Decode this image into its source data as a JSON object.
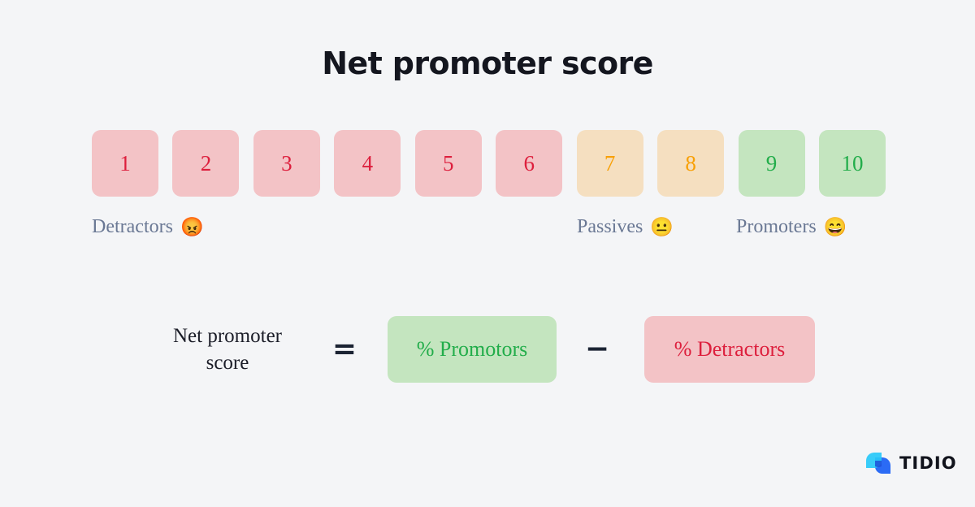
{
  "page": {
    "title": "Net promoter score",
    "background_color": "#f4f5f7"
  },
  "scale": {
    "boxes": [
      {
        "value": "1",
        "segment": "detractor",
        "bg": "#f3c3c6",
        "fg": "#dd1f3d"
      },
      {
        "value": "2",
        "segment": "detractor",
        "bg": "#f3c3c6",
        "fg": "#dd1f3d"
      },
      {
        "value": "3",
        "segment": "detractor",
        "bg": "#f3c3c6",
        "fg": "#dd1f3d"
      },
      {
        "value": "4",
        "segment": "detractor",
        "bg": "#f3c3c6",
        "fg": "#dd1f3d"
      },
      {
        "value": "5",
        "segment": "detractor",
        "bg": "#f3c3c6",
        "fg": "#dd1f3d"
      },
      {
        "value": "6",
        "segment": "detractor",
        "bg": "#f3c3c6",
        "fg": "#dd1f3d"
      },
      {
        "value": "7",
        "segment": "passive",
        "bg": "#f5dfc0",
        "fg": "#f8a006"
      },
      {
        "value": "8",
        "segment": "passive",
        "bg": "#f5dfc0",
        "fg": "#f8a006"
      },
      {
        "value": "9",
        "segment": "promoter",
        "bg": "#c4e5bf",
        "fg": "#22ad4a"
      },
      {
        "value": "10",
        "segment": "promoter",
        "bg": "#c4e5bf",
        "fg": "#22ad4a"
      }
    ]
  },
  "segments": [
    {
      "label": "Detractors",
      "emoji": "😡",
      "emoji_name": "angry-face-emoji",
      "range": "1-6"
    },
    {
      "label": "Passives",
      "emoji": "😐",
      "emoji_name": "neutral-face-emoji",
      "range": "7-8"
    },
    {
      "label": "Promoters",
      "emoji": "😄",
      "emoji_name": "grinning-face-emoji",
      "range": "9-10"
    }
  ],
  "formula": {
    "left_line1": "Net promoter",
    "left_line2": "score",
    "equals": "=",
    "minus": "−",
    "promotors_term": "% Promotors",
    "detractors_term": "% Detractors"
  },
  "logo": {
    "wordmark": "TIDIO",
    "mark_name": "tidio-chat-bubble-logo",
    "cyan": "#27c8f8",
    "blue": "#2b6bf5"
  },
  "chart_data": {
    "type": "bar",
    "title": "Net promoter score",
    "categories": [
      "1",
      "2",
      "3",
      "4",
      "5",
      "6",
      "7",
      "8",
      "9",
      "10"
    ],
    "values": [
      1,
      2,
      3,
      4,
      5,
      6,
      7,
      8,
      9,
      10
    ],
    "series": [
      {
        "name": "Detractors",
        "categories": [
          "1",
          "2",
          "3",
          "4",
          "5",
          "6"
        ],
        "color": "#f3c3c6"
      },
      {
        "name": "Passives",
        "categories": [
          "7",
          "8"
        ],
        "color": "#f5dfc0"
      },
      {
        "name": "Promoters",
        "categories": [
          "9",
          "10"
        ],
        "color": "#c4e5bf"
      }
    ],
    "xlabel": "",
    "ylabel": "",
    "legend_position": "below",
    "grid": false,
    "annotations": [
      "Net promoter score = % Promotors − % Detractors"
    ]
  }
}
